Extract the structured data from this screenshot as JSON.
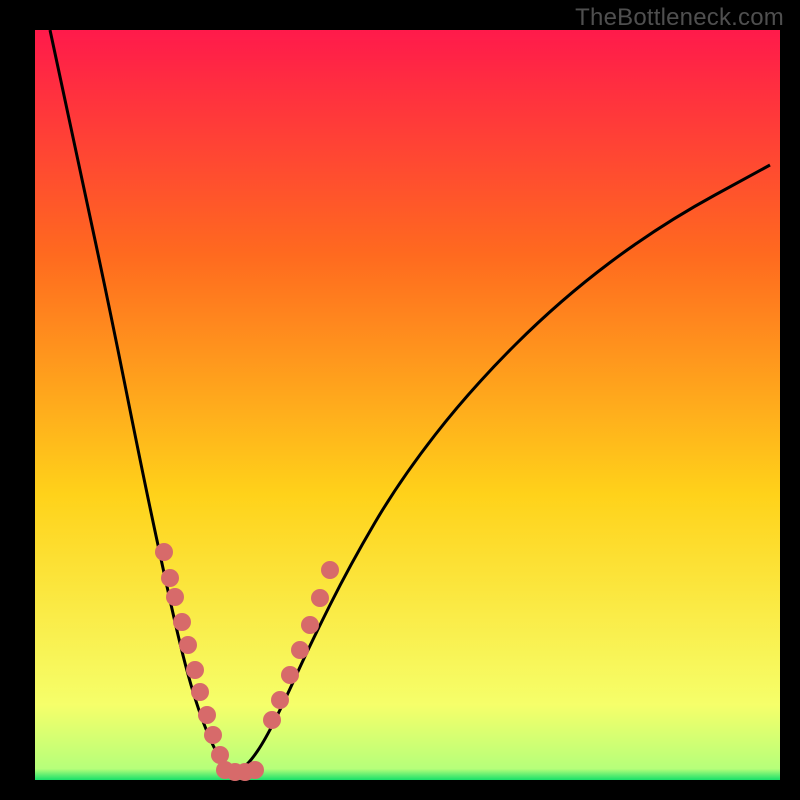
{
  "watermark": "TheBottleneck.com",
  "colors": {
    "bg_black": "#000000",
    "grad_top": "#ff1a4b",
    "grad_upper_mid": "#ff6a1f",
    "grad_mid": "#ffd21a",
    "grad_lower": "#f6ff6a",
    "grad_bottom_green": "#18e06a",
    "curve": "#000000",
    "dot_fill": "#d76a6a",
    "dot_alt": "#d98080",
    "watermark": "#4f4f4f"
  },
  "chart_data": {
    "type": "line",
    "title": "",
    "xlabel": "",
    "ylabel": "",
    "xlim": [
      35,
      780
    ],
    "ylim": [
      780,
      30
    ],
    "annotations": [
      "TheBottleneck.com"
    ],
    "legend": [],
    "grid": false,
    "series": [
      {
        "name": "bottleneck-curve",
        "description": "Black V-shaped curve falling steeply from top-left to a minimum near x≈230 then rising with decreasing slope toward upper-right.",
        "x": [
          50,
          80,
          110,
          140,
          160,
          180,
          195,
          210,
          222,
          232,
          240,
          250,
          265,
          285,
          310,
          350,
          400,
          470,
          560,
          660,
          770
        ],
        "y": [
          30,
          170,
          310,
          460,
          555,
          645,
          700,
          740,
          762,
          770,
          770,
          762,
          740,
          700,
          645,
          565,
          480,
          390,
          300,
          225,
          165
        ]
      },
      {
        "name": "left-arm-dots",
        "description": "Pink scatter dots along the lower part of the descending arm.",
        "type": "scatter",
        "x": [
          164,
          170,
          175,
          182,
          188,
          195,
          200,
          207,
          213,
          220
        ],
        "y": [
          552,
          578,
          597,
          622,
          645,
          670,
          692,
          715,
          735,
          755
        ]
      },
      {
        "name": "valley-dots",
        "description": "Pink scatter dots across the curve minimum.",
        "type": "scatter",
        "x": [
          225,
          235,
          245,
          255
        ],
        "y": [
          770,
          772,
          772,
          770
        ]
      },
      {
        "name": "right-arm-dots",
        "description": "Pink scatter dots along the lower part of the ascending arm.",
        "type": "scatter",
        "x": [
          272,
          280,
          290,
          300,
          310,
          320,
          330
        ],
        "y": [
          720,
          700,
          675,
          650,
          625,
          598,
          570
        ]
      }
    ]
  }
}
